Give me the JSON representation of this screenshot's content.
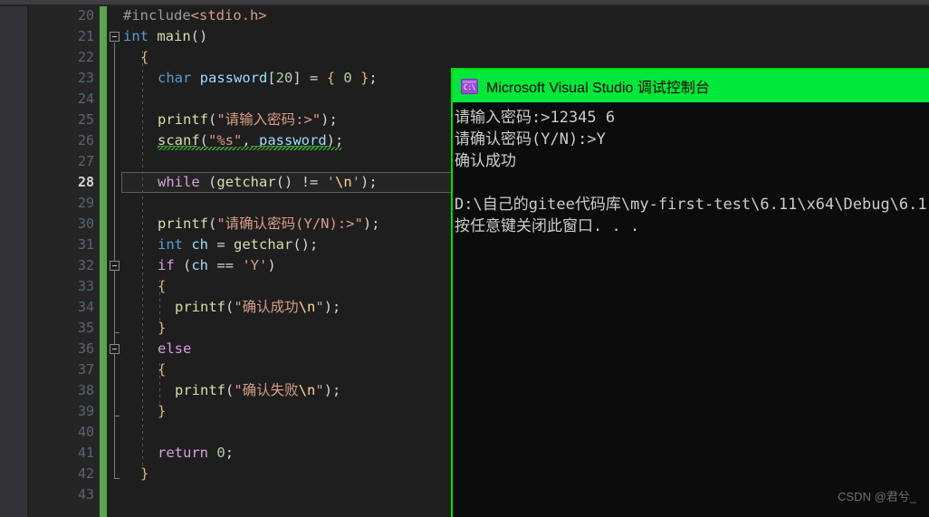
{
  "editor": {
    "first_line": 20,
    "current_line": 28,
    "lines": [
      {
        "no": 20,
        "indent": 0,
        "tokens": [
          {
            "t": "#include",
            "c": "pp"
          },
          {
            "t": "<stdio.h>",
            "c": "str"
          }
        ]
      },
      {
        "no": 21,
        "indent": 0,
        "tokens": [
          {
            "t": "int",
            "c": "k-blue"
          },
          {
            "t": " ",
            "c": "punct"
          },
          {
            "t": "main",
            "c": "fn"
          },
          {
            "t": "()",
            "c": "punct"
          }
        ]
      },
      {
        "no": 22,
        "indent": 1,
        "tokens": [
          {
            "t": "{",
            "c": "brace"
          }
        ]
      },
      {
        "no": 23,
        "indent": 2,
        "tokens": [
          {
            "t": "char",
            "c": "k-blue"
          },
          {
            "t": " ",
            "c": "punct"
          },
          {
            "t": "password",
            "c": "id-lb"
          },
          {
            "t": "[",
            "c": "punct"
          },
          {
            "t": "20",
            "c": "num"
          },
          {
            "t": "]",
            "c": "punct"
          },
          {
            "t": " = ",
            "c": "punct"
          },
          {
            "t": "{",
            "c": "brace"
          },
          {
            "t": " ",
            "c": "punct"
          },
          {
            "t": "0",
            "c": "num"
          },
          {
            "t": " ",
            "c": "punct"
          },
          {
            "t": "}",
            "c": "brace"
          },
          {
            "t": ";",
            "c": "punct"
          }
        ]
      },
      {
        "no": 24,
        "indent": 2,
        "tokens": []
      },
      {
        "no": 25,
        "indent": 2,
        "tokens": [
          {
            "t": "printf",
            "c": "fn"
          },
          {
            "t": "(",
            "c": "punct"
          },
          {
            "t": "\"请输入密码:>\"",
            "c": "str"
          },
          {
            "t": ")",
            "c": "punct"
          },
          {
            "t": ";",
            "c": "punct"
          }
        ]
      },
      {
        "no": 26,
        "indent": 2,
        "tokens": [
          {
            "t": "scanf",
            "c": "fn"
          },
          {
            "t": "(",
            "c": "punct"
          },
          {
            "t": "\"%s\"",
            "c": "str"
          },
          {
            "t": ", ",
            "c": "punct"
          },
          {
            "t": "password",
            "c": "id-lb"
          },
          {
            "t": ")",
            "c": "punct"
          },
          {
            "t": ";",
            "c": "punct"
          }
        ]
      },
      {
        "no": 27,
        "indent": 2,
        "tokens": []
      },
      {
        "no": 28,
        "indent": 2,
        "tokens": [
          {
            "t": "while",
            "c": "k-mag"
          },
          {
            "t": " ",
            "c": "punct"
          },
          {
            "t": "(",
            "c": "punct"
          },
          {
            "t": "getchar",
            "c": "fn"
          },
          {
            "t": "()",
            "c": "punct"
          },
          {
            "t": " != ",
            "c": "punct"
          },
          {
            "t": "'",
            "c": "str"
          },
          {
            "t": "\\n",
            "c": "esc"
          },
          {
            "t": "'",
            "c": "str"
          },
          {
            "t": ")",
            "c": "punct"
          },
          {
            "t": ";",
            "c": "punct"
          }
        ]
      },
      {
        "no": 29,
        "indent": 2,
        "tokens": []
      },
      {
        "no": 30,
        "indent": 2,
        "tokens": [
          {
            "t": "printf",
            "c": "fn"
          },
          {
            "t": "(",
            "c": "punct"
          },
          {
            "t": "\"请确认密码(Y/N):>\"",
            "c": "str"
          },
          {
            "t": ")",
            "c": "punct"
          },
          {
            "t": ";",
            "c": "punct"
          }
        ]
      },
      {
        "no": 31,
        "indent": 2,
        "tokens": [
          {
            "t": "int",
            "c": "k-blue"
          },
          {
            "t": " ",
            "c": "punct"
          },
          {
            "t": "ch",
            "c": "id-lb"
          },
          {
            "t": " = ",
            "c": "punct"
          },
          {
            "t": "getchar",
            "c": "fn"
          },
          {
            "t": "()",
            "c": "punct"
          },
          {
            "t": ";",
            "c": "punct"
          }
        ]
      },
      {
        "no": 32,
        "indent": 2,
        "tokens": [
          {
            "t": "if",
            "c": "k-mag"
          },
          {
            "t": " (",
            "c": "punct"
          },
          {
            "t": "ch",
            "c": "id-lb"
          },
          {
            "t": " == ",
            "c": "punct"
          },
          {
            "t": "'Y'",
            "c": "str"
          },
          {
            "t": ")",
            "c": "punct"
          }
        ]
      },
      {
        "no": 33,
        "indent": 2,
        "tokens": [
          {
            "t": "{",
            "c": "brace"
          }
        ]
      },
      {
        "no": 34,
        "indent": 3,
        "tokens": [
          {
            "t": "printf",
            "c": "fn"
          },
          {
            "t": "(",
            "c": "punct"
          },
          {
            "t": "\"确认成功",
            "c": "str"
          },
          {
            "t": "\\n",
            "c": "esc"
          },
          {
            "t": "\"",
            "c": "str"
          },
          {
            "t": ")",
            "c": "punct"
          },
          {
            "t": ";",
            "c": "punct"
          }
        ]
      },
      {
        "no": 35,
        "indent": 2,
        "tokens": [
          {
            "t": "}",
            "c": "brace"
          }
        ]
      },
      {
        "no": 36,
        "indent": 2,
        "tokens": [
          {
            "t": "else",
            "c": "k-mag"
          }
        ]
      },
      {
        "no": 37,
        "indent": 2,
        "tokens": [
          {
            "t": "{",
            "c": "brace"
          }
        ]
      },
      {
        "no": 38,
        "indent": 3,
        "tokens": [
          {
            "t": "printf",
            "c": "fn"
          },
          {
            "t": "(",
            "c": "punct"
          },
          {
            "t": "\"确认失败",
            "c": "str"
          },
          {
            "t": "\\n",
            "c": "esc"
          },
          {
            "t": "\"",
            "c": "str"
          },
          {
            "t": ")",
            "c": "punct"
          },
          {
            "t": ";",
            "c": "punct"
          }
        ]
      },
      {
        "no": 39,
        "indent": 2,
        "tokens": [
          {
            "t": "}",
            "c": "brace"
          }
        ]
      },
      {
        "no": 40,
        "indent": 2,
        "tokens": []
      },
      {
        "no": 41,
        "indent": 2,
        "tokens": [
          {
            "t": "return",
            "c": "k-mag"
          },
          {
            "t": " ",
            "c": "punct"
          },
          {
            "t": "0",
            "c": "num"
          },
          {
            "t": ";",
            "c": "punct"
          }
        ]
      },
      {
        "no": 42,
        "indent": 1,
        "tokens": [
          {
            "t": "}",
            "c": "brace"
          }
        ]
      },
      {
        "no": 43,
        "indent": 0,
        "tokens": []
      }
    ]
  },
  "console": {
    "icon": "visual-studio-console-icon",
    "icon_text": "C:\\",
    "title": "Microsoft Visual Studio 调试控制台",
    "title_bg": "#00e83c",
    "border_color": "#00e000",
    "background": "#0c0c0c",
    "text_color": "#cccccc",
    "lines": [
      "请输入密码:>12345 6",
      "请确认密码(Y/N):>Y",
      "确认成功",
      "",
      "D:\\自己的gitee代码库\\my-first-test\\6.11\\x64\\Debug\\6.1",
      "按任意键关闭此窗口. . ."
    ]
  },
  "watermark": {
    "text": "CSDN @君兮_"
  },
  "theme": {
    "editor_bg": "#1e1e1e",
    "gutter_bg": "#252526",
    "rail_bg": "#333337",
    "changebar": "#57a64a",
    "lineno": "#5a6570",
    "lineno_current": "#d4d4d4"
  }
}
